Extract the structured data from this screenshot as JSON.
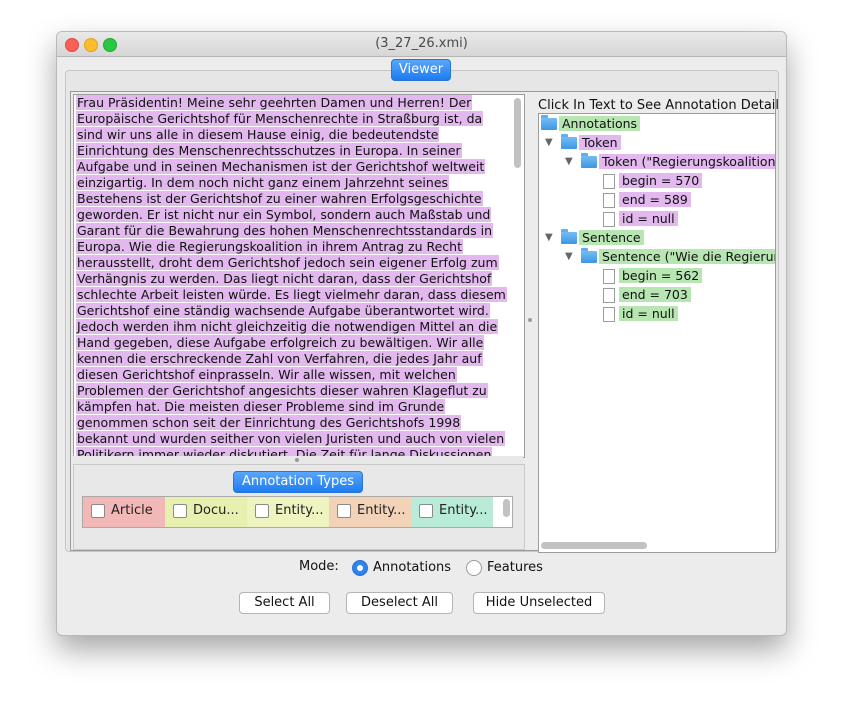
{
  "window": {
    "title": "(3_27_26.xmi)"
  },
  "viewer": {
    "label": "Viewer"
  },
  "document": {
    "lines": [
      "Frau Präsidentin! Meine sehr geehrten Damen und Herren! Der",
      "Europäische Gerichtshof für Menschenrechte in Straßburg ist, da",
      "sind wir uns alle in diesem Hause einig, die bedeutendste",
      "Einrichtung des Menschenrechtsschutzes in Europa. In seiner",
      "Aufgabe und in seinen Mechanismen ist der Gerichtshof weltweit",
      "einzigartig. In dem noch nicht ganz einem Jahrzehnt seines",
      "Bestehens ist der Gerichtshof zu einer wahren Erfolgsgeschichte",
      "geworden. Er ist nicht nur ein Symbol, sondern auch Maßstab und",
      "Garant für die Bewahrung des hohen Menschenrechtsstandards in",
      "Europa. Wie die Regierungskoalition in ihrem Antrag zu Recht",
      "herausstellt, droht dem Gerichtshof jedoch sein eigener Erfolg zum",
      "Verhängnis zu werden. Das liegt nicht daran, dass der Gerichtshof",
      "schlechte Arbeit leisten würde. Es liegt vielmehr daran, dass diesem",
      "Gerichtshof eine ständig wachsende Aufgabe überantwortet wird.",
      "Jedoch werden ihm nicht gleichzeitig die notwendigen Mittel an die",
      "Hand gegeben, diese Aufgabe erfolgreich zu bewältigen. Wir alle",
      "kennen die erschreckende Zahl von Verfahren, die jedes Jahr auf",
      "diesen Gerichtshof einprasseln. Wir alle wissen, mit welchen",
      "Problemen der Gerichtshof angesichts dieser wahren Klageflut zu",
      "kämpfen hat. Die meisten dieser Probleme sind im Grunde",
      "genommen schon seit der Einrichtung des Gerichtshofs 1998",
      "bekannt und wurden seither von vielen Juristen und auch von vielen",
      "Politikern immer wieder diskutiert. Die Zeit für lange Diskussionen"
    ]
  },
  "annotation_types": {
    "button_label": "Annotation Types",
    "items": [
      {
        "label": "Article",
        "color": "#f2b8b8"
      },
      {
        "label": "Docu...",
        "color": "#e8f0b0"
      },
      {
        "label": "Entity...",
        "color": "#eef3c0"
      },
      {
        "label": "Entity...",
        "color": "#f3d3b8"
      },
      {
        "label": "Entity...",
        "color": "#b8ecd8"
      }
    ]
  },
  "tree": {
    "header": "Click In Text to See Annotation Detail",
    "nodes": [
      {
        "label": "Annotations",
        "color": "green"
      },
      {
        "label": "Token",
        "color": "purple"
      },
      {
        "label": "Token (\"Regierungskoalition\")",
        "color": "purple"
      },
      {
        "label": "begin = 570",
        "color": "purple"
      },
      {
        "label": "end = 589",
        "color": "purple"
      },
      {
        "label": "id = null",
        "color": "purple"
      },
      {
        "label": "Sentence",
        "color": "green"
      },
      {
        "label": "Sentence (\"Wie die Regierungsk",
        "color": "green"
      },
      {
        "label": "begin = 562",
        "color": "green"
      },
      {
        "label": "end = 703",
        "color": "green"
      },
      {
        "label": "id = null",
        "color": "green"
      }
    ]
  },
  "mode": {
    "label": "Mode:",
    "options": [
      {
        "label": "Annotations",
        "selected": true
      },
      {
        "label": "Features",
        "selected": false
      }
    ]
  },
  "buttons": {
    "select_all": "Select All",
    "deselect_all": "Deselect All",
    "hide_unselected": "Hide Unselected"
  }
}
